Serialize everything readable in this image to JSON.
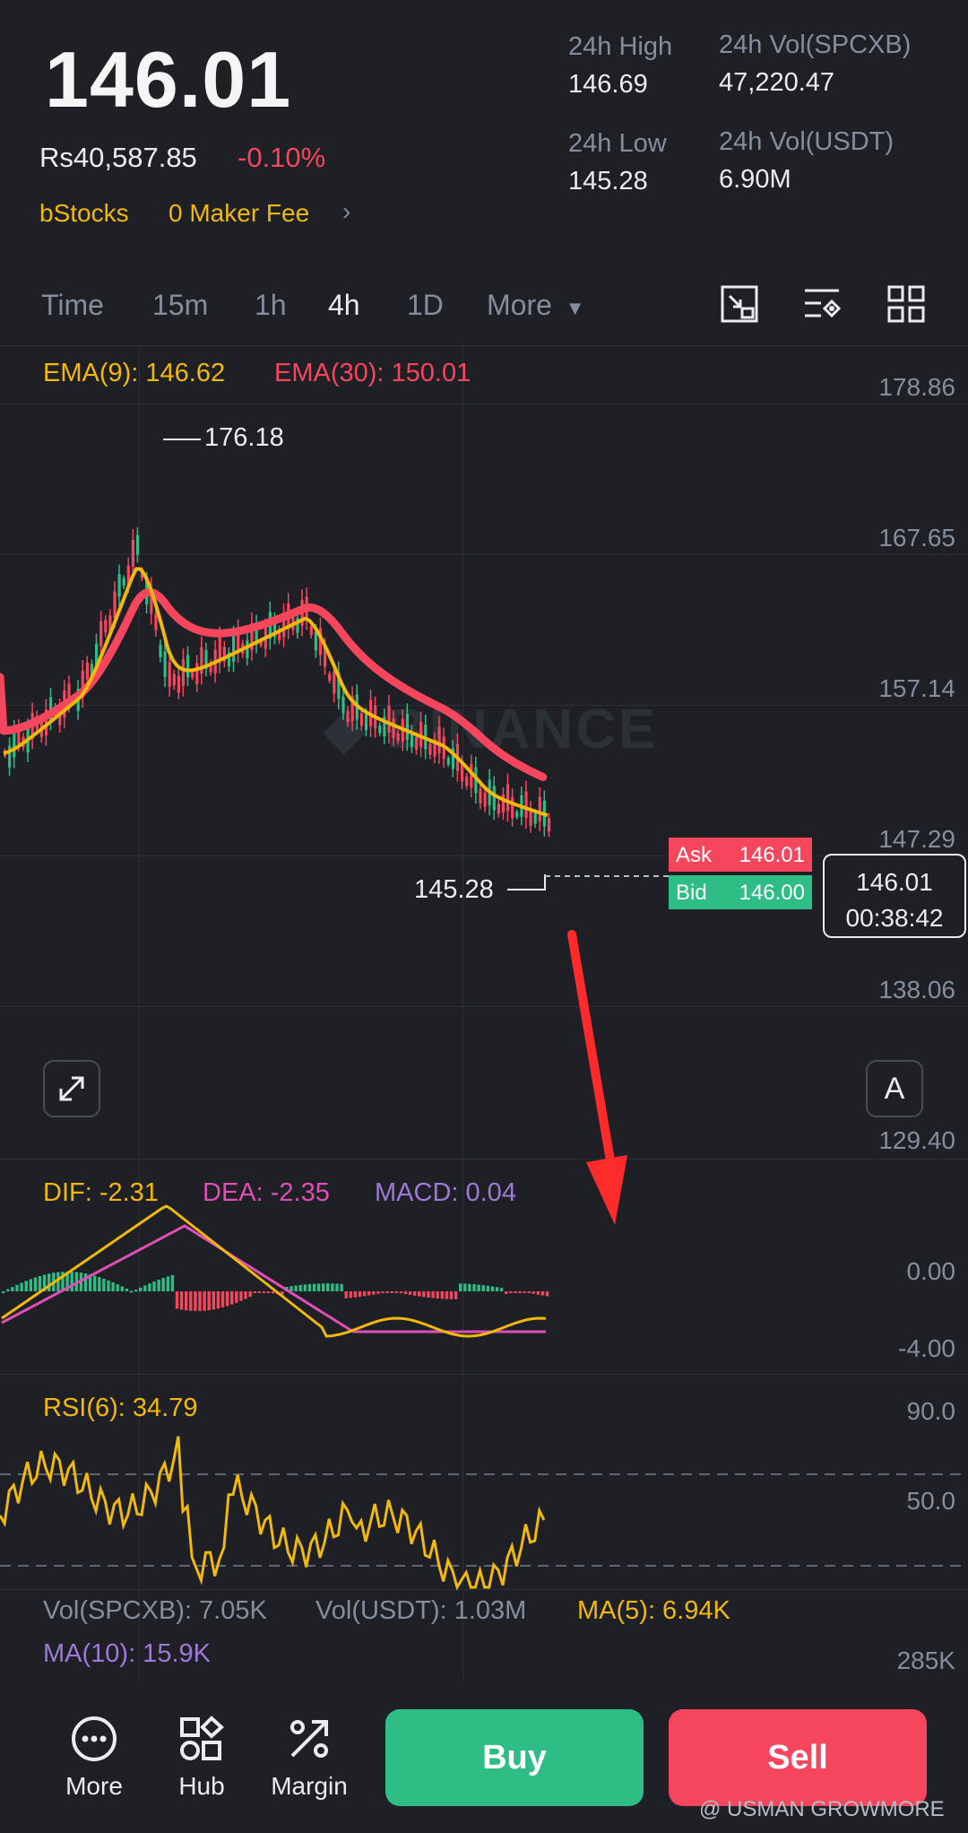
{
  "header": {
    "last_price": "146.01",
    "fiat_price": "Rs40,587.85",
    "change_pct": "-0.10%",
    "tag": "bStocks",
    "promo": "0 Maker Fee",
    "stats": {
      "high_label": "24h High",
      "high_value": "146.69",
      "low_label": "24h Low",
      "low_value": "145.28",
      "vol_base_label": "24h Vol(SPCXB)",
      "vol_base_value": "47,220.47",
      "vol_quote_label": "24h Vol(USDT)",
      "vol_quote_value": "6.90M"
    }
  },
  "timeframes": [
    "Time",
    "15m",
    "1h",
    "4h",
    "1D",
    "More"
  ],
  "active_timeframe": "4h",
  "toolbar_icons": [
    "chart-type-icon",
    "indicator-settings-icon",
    "grid-layout-icon"
  ],
  "indicators": {
    "ema9": "EMA(9): 146.62",
    "ema30": "EMA(30): 150.01",
    "dif": "DIF: -2.31",
    "dea": "DEA: -2.35",
    "macd": "MACD: 0.04",
    "rsi": "RSI(6): 34.79",
    "vol_base": "Vol(SPCXB): 7.05K",
    "vol_quote": "Vol(USDT): 1.03M",
    "ma5": "MA(5): 6.94K",
    "ma10": "MA(10): 15.9K"
  },
  "price_axis": [
    "178.86",
    "167.65",
    "157.14",
    "147.29",
    "138.06",
    "129.40"
  ],
  "macd_axis": [
    "0.00",
    "-4.00"
  ],
  "rsi_axis": [
    "90.0",
    "50.0"
  ],
  "vol_axis": "285K",
  "chart_marks": {
    "high": "176.18",
    "low": "145.28"
  },
  "order_book": {
    "ask_label": "Ask",
    "ask_value": "146.01",
    "bid_label": "Bid",
    "bid_value": "146.00"
  },
  "current_price_box": {
    "price": "146.01",
    "countdown": "00:38:42"
  },
  "watermark": "BINANCE",
  "expand_button": "expand-icon",
  "auto_button": "A",
  "bottom_nav": {
    "more": "More",
    "hub": "Hub",
    "margin": "Margin"
  },
  "actions": {
    "buy": "Buy",
    "sell": "Sell"
  },
  "credit": "@ USMAN GROWMORE",
  "colors": {
    "up": "#2ebd85",
    "down": "#f6465d",
    "ema9": "#f0b90b",
    "ema30": "#f6465d",
    "dea": "#e04fb5",
    "macd": "#9c7ad6",
    "bg": "#1e2026"
  }
}
